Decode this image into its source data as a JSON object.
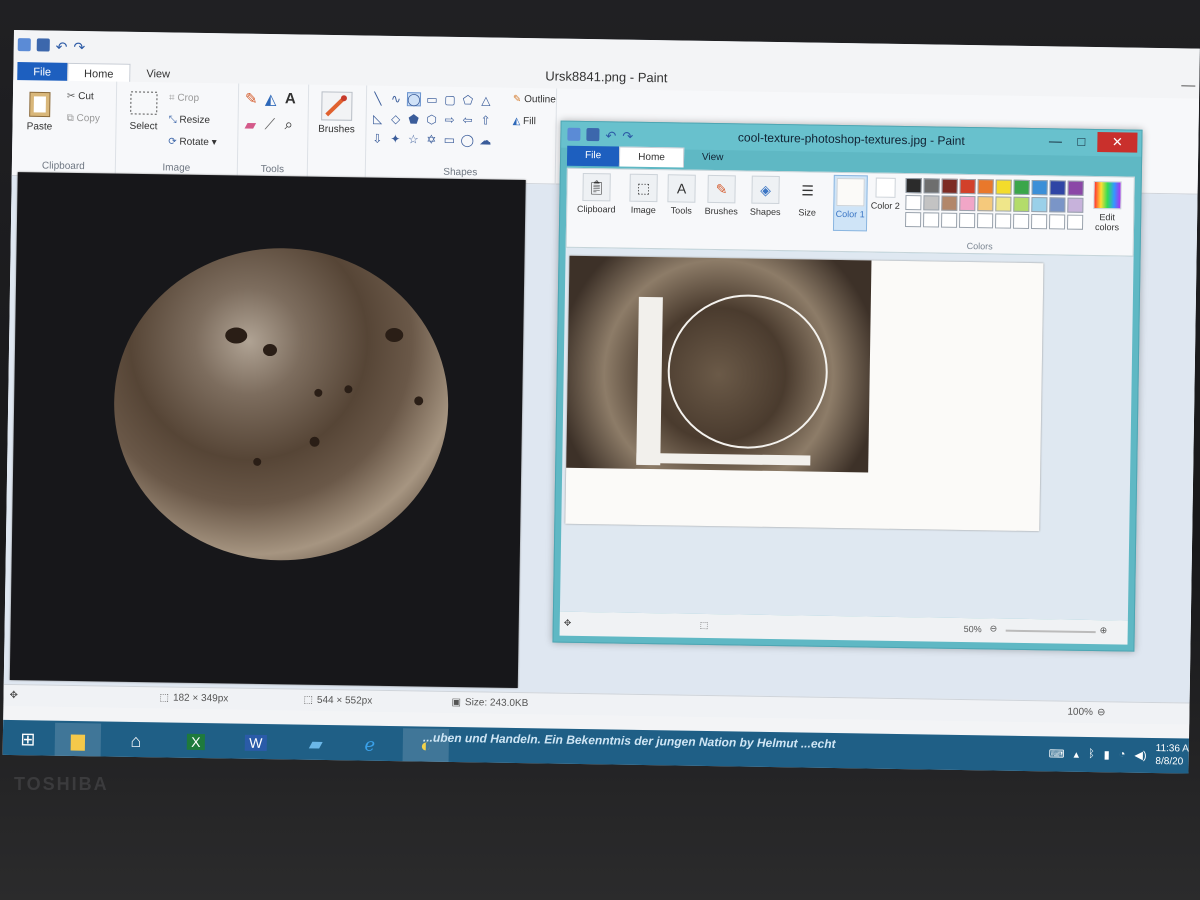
{
  "back_window": {
    "title": "Ursk8841.png - Paint",
    "tabs": [
      "File",
      "Home",
      "View"
    ],
    "clipboard": {
      "paste": "Paste",
      "cut": "Cut",
      "copy": "Copy",
      "group": "Clipboard"
    },
    "image": {
      "select": "Select",
      "crop": "Crop",
      "resize": "Resize",
      "rotate": "Rotate",
      "group": "Image"
    },
    "tools": {
      "group": "Tools",
      "brushes": "Brushes"
    },
    "shapes": {
      "group": "Shapes",
      "outline": "Outline",
      "fill": "Fill"
    },
    "status": {
      "selection": "182 × 349px",
      "canvas": "544 × 552px",
      "size": "Size: 243.0KB",
      "zoom": "100%"
    }
  },
  "front_window": {
    "title": "cool-texture-photoshop-textures.jpg - Paint",
    "tabs": [
      "File",
      "Home",
      "View"
    ],
    "groups": {
      "clipboard": "Clipboard",
      "image": "Image",
      "tools": "Tools",
      "brushes": "Brushes",
      "shapes": "Shapes",
      "size": "Size",
      "color1": "Color 1",
      "color2": "Color 2",
      "edit_colors": "Edit colors",
      "colors": "Colors"
    },
    "palette": [
      "#2b2b2b",
      "#6e6e6e",
      "#7d2b23",
      "#d2402a",
      "#e9782b",
      "#f3dc2b",
      "#3aa64a",
      "#3b8fd8",
      "#2f45a5",
      "#8b47a7",
      "#ffffff",
      "#c3c3c3",
      "#b2876a",
      "#f1a6c7",
      "#f5c97c",
      "#efe68a",
      "#b3dc6a",
      "#9ad0e9",
      "#7a95c7",
      "#c7b2db",
      "#ffffff",
      "#ffffff",
      "#ffffff",
      "#ffffff",
      "#ffffff",
      "#ffffff",
      "#ffffff",
      "#ffffff",
      "#ffffff",
      "#ffffff"
    ],
    "status": {
      "zoom": "50%"
    }
  },
  "taskbar": {
    "banner": "...uben und Handeln. Ein Bekenntnis der jungen Nation by Helmut ...echt",
    "time": "11:36 A",
    "date": "8/8/20"
  },
  "laptop_brand": "TOSHIBA"
}
